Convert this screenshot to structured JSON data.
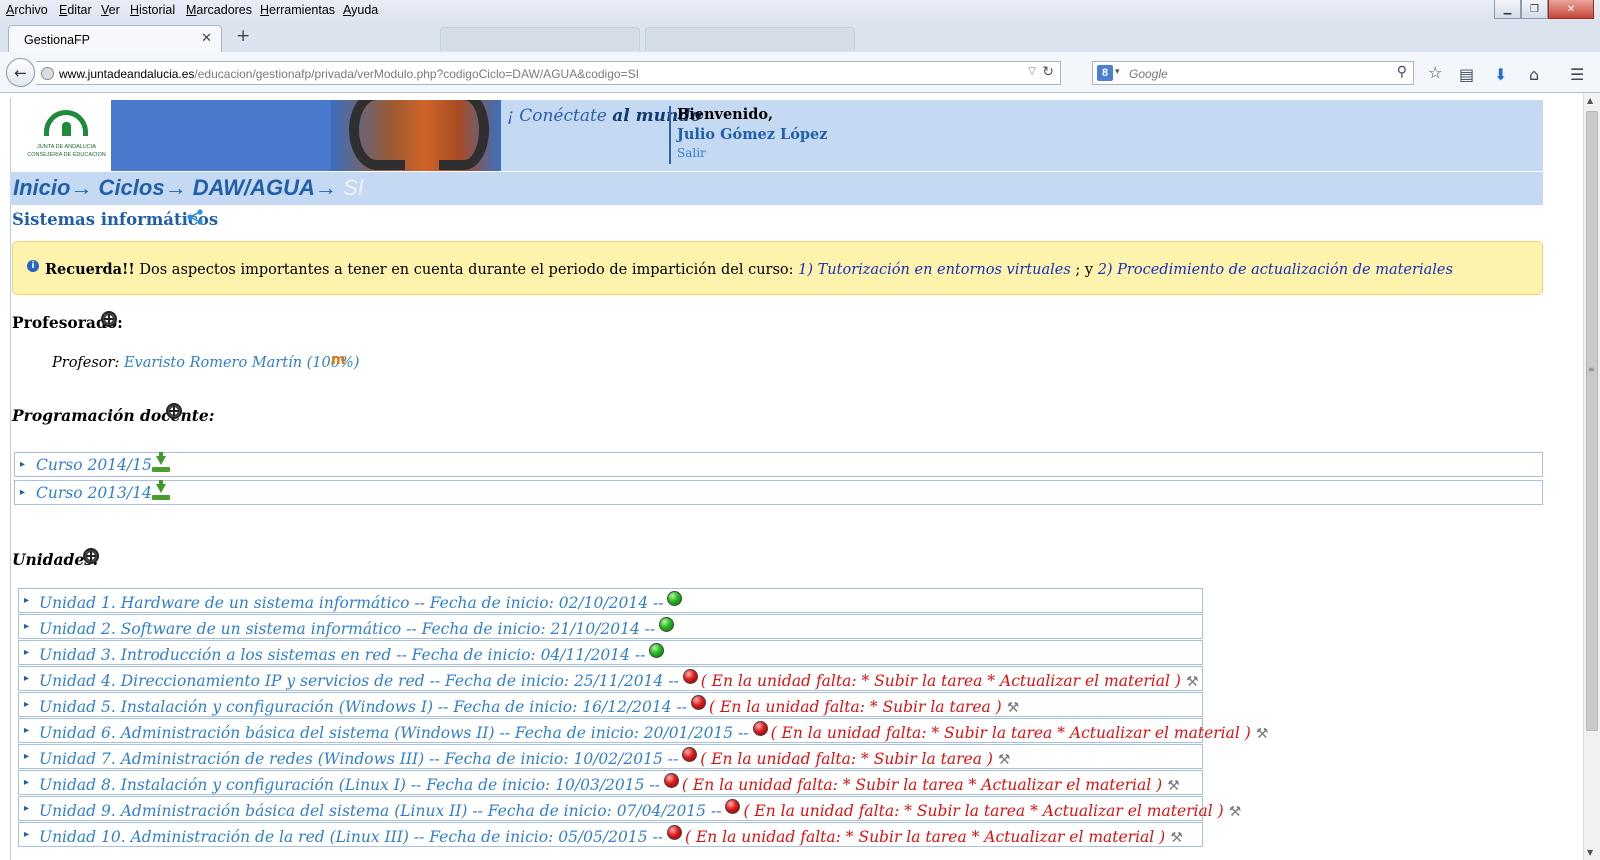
{
  "browser": {
    "menu": [
      "Archivo",
      "Editar",
      "Ver",
      "Historial",
      "Marcadores",
      "Herramientas",
      "Ayuda"
    ],
    "tab_title": "GestionaFP",
    "url_host": "www.juntadeandalucia.es",
    "url_path": "/educacion/gestionafp/privada/verModulo.php?codigoCiclo=DAW/AGUA&codigo=SI",
    "search_placeholder": "Google"
  },
  "header": {
    "logo_line1": "JUNTA DE ANDALUCIA",
    "logo_line2": "CONSEJERIA DE EDUCACION",
    "slogan_pre": "¡ Conéctate ",
    "slogan_post": "al mundo",
    "welcome": "Bienvenido,",
    "user": "Julio Gómez López",
    "logout": "Salir"
  },
  "breadcrumb": {
    "path": "Inicio→ Ciclos→ DAW/AGUA→ ",
    "current": "SI"
  },
  "module": {
    "title": "Sistemas informáticos"
  },
  "notice": {
    "strong": "Recuerda!!",
    "text": " Dos aspectos importantes a tener en cuenta durante el periodo de impartición del curso: ",
    "link1": "1) Tutorización en entornos virtuales",
    "sep": " ; y ",
    "link2": "2) Procedimiento de actualización de materiales"
  },
  "teachers": {
    "heading": "Profesorado:",
    "label": "Profesor: ",
    "name": "Evaristo Romero Martín (100%)"
  },
  "programming": {
    "heading": "Programación docente:",
    "years": [
      "Curso 2014/15",
      "Curso 2013/14"
    ]
  },
  "units": {
    "heading": "Unidades:",
    "items": [
      {
        "text": "Unidad 1. Hardware de un sistema informático -- Fecha de inicio: 02/10/2014 --",
        "status": "green",
        "missing": ""
      },
      {
        "text": "Unidad 2. Software de un sistema informático -- Fecha de inicio: 21/10/2014 --",
        "status": "green",
        "missing": ""
      },
      {
        "text": "Unidad 3. Introducción a los sistemas en red -- Fecha de inicio: 04/11/2014 --",
        "status": "green",
        "missing": ""
      },
      {
        "text": "Unidad 4. Direccionamiento IP y servicios de red -- Fecha de inicio: 25/11/2014 --",
        "status": "red",
        "missing": "( En la unidad falta: * Subir la tarea * Actualizar el material )"
      },
      {
        "text": "Unidad 5. Instalación y configuración (Windows I) -- Fecha de inicio: 16/12/2014 --",
        "status": "red",
        "missing": "( En la unidad falta: * Subir la tarea )"
      },
      {
        "text": "Unidad 6. Administración básica del sistema (Windows II) -- Fecha de inicio: 20/01/2015 --",
        "status": "red",
        "missing": "( En la unidad falta: * Subir la tarea * Actualizar el material )"
      },
      {
        "text": "Unidad 7. Administración de redes (Windows III) -- Fecha de inicio: 10/02/2015 --",
        "status": "red",
        "missing": "( En la unidad falta: * Subir la tarea )"
      },
      {
        "text": "Unidad 8. Instalación y configuración (Linux I) -- Fecha de inicio: 10/03/2015 --",
        "status": "red",
        "missing": "( En la unidad falta: * Subir la tarea * Actualizar el material )"
      },
      {
        "text": "Unidad 9. Administración básica del sistema (Linux II) -- Fecha de inicio: 07/04/2015 --",
        "status": "red",
        "missing": "( En la unidad falta: * Subir la tarea * Actualizar el material )"
      },
      {
        "text": "Unidad 10. Administración de la red (Linux III) -- Fecha de inicio: 05/05/2015 --",
        "status": "red",
        "missing": "( En la unidad falta: * Subir la tarea * Actualizar el material )"
      }
    ]
  }
}
